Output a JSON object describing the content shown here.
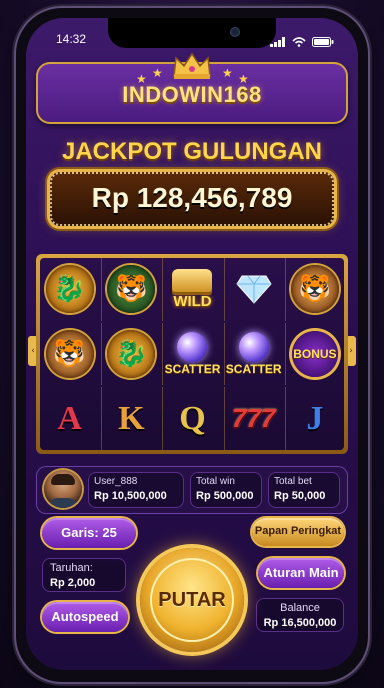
{
  "status_bar": {
    "time": "14:32"
  },
  "brand": {
    "logo_text": "INDOWIN168"
  },
  "jackpot": {
    "title": "JACKPOT GULUNGAN",
    "value": "Rp 128,456,789"
  },
  "reels": {
    "row1": [
      {
        "symbol": "dragon",
        "label": ""
      },
      {
        "symbol": "tiger-green",
        "label": ""
      },
      {
        "symbol": "wild",
        "label": "WILD"
      },
      {
        "symbol": "diamond",
        "label": ""
      },
      {
        "symbol": "tiger",
        "label": ""
      }
    ],
    "row2": [
      {
        "symbol": "tiger",
        "label": ""
      },
      {
        "symbol": "dragon",
        "label": ""
      },
      {
        "symbol": "scatter",
        "label": "SCATTER"
      },
      {
        "symbol": "scatter",
        "label": "SCATTER"
      },
      {
        "symbol": "bonus",
        "label": "BONUS"
      }
    ],
    "row3": [
      {
        "symbol": "letter",
        "label": "A"
      },
      {
        "symbol": "letter",
        "label": "K"
      },
      {
        "symbol": "letter",
        "label": "Q"
      },
      {
        "symbol": "777",
        "label": "777"
      },
      {
        "symbol": "letter",
        "label": "J"
      }
    ]
  },
  "player": {
    "username": "User_888",
    "balance": "Rp 10,500,000"
  },
  "totals": {
    "total_win_label": "Total win",
    "total_win_value": "Rp 500,000",
    "total_bet_label": "Total bet",
    "total_bet_value": "Rp 50,000"
  },
  "controls": {
    "lines_label": "Garis: 25",
    "leaderboard_label": "Papan Peringkat",
    "bet_label": "Taruhan:",
    "bet_value": "Rp 2,000",
    "rules_label": "Aturan Main",
    "autospeed_label": "Autospeed",
    "spin_label": "PUTAR",
    "balance_label": "Balance",
    "balance_value": "Rp 16,500,000"
  },
  "colors": {
    "accent_gold": "#e7b54a",
    "primary_purple": "#6a1fb0",
    "background": "#2b0f52"
  }
}
